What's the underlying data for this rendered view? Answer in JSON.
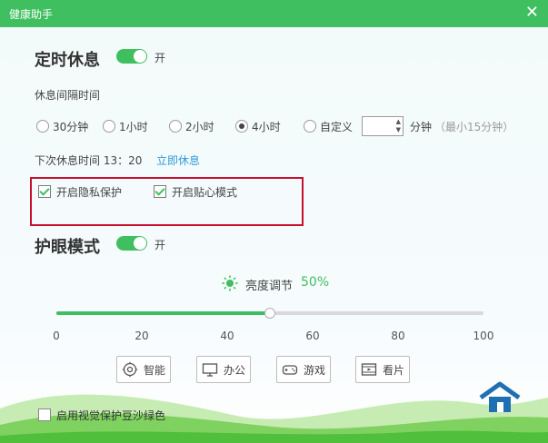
{
  "window": {
    "title": "健康助手",
    "close_symbol": "✕"
  },
  "timed_rest": {
    "title": "定时休息",
    "toggle_state": "开",
    "interval_label": "休息间隔时间",
    "options": [
      "30分钟",
      "1小时",
      "2小时",
      "4小时",
      "自定义"
    ],
    "selected_option": "4小时",
    "custom_unit": "分钟",
    "custom_hint": "（最小15分钟）",
    "custom_value": "",
    "next_rest_label": "下次休息时间 13：20",
    "rest_now_link": "立即休息",
    "privacy_checkbox": "开启隐私保护",
    "care_checkbox": "开启贴心模式"
  },
  "eye_protection": {
    "title": "护眼模式",
    "toggle_state": "开",
    "brightness_label": "亮度调节",
    "brightness_value_text": "50%",
    "brightness_value": 50,
    "slider_ticks": [
      "0",
      "20",
      "40",
      "60",
      "80",
      "100"
    ],
    "modes": [
      "智能",
      "办公",
      "游戏",
      "看片"
    ],
    "green_bean_checkbox": "启用视觉保护豆沙绿色"
  },
  "colors": {
    "accent": "#3fbf5f",
    "link": "#2e9bdb",
    "highlight_box": "#c8102e"
  },
  "icons": [
    "close-icon",
    "sun-icon",
    "smart-icon",
    "monitor-icon",
    "gamepad-icon",
    "film-icon",
    "house-icon"
  ]
}
